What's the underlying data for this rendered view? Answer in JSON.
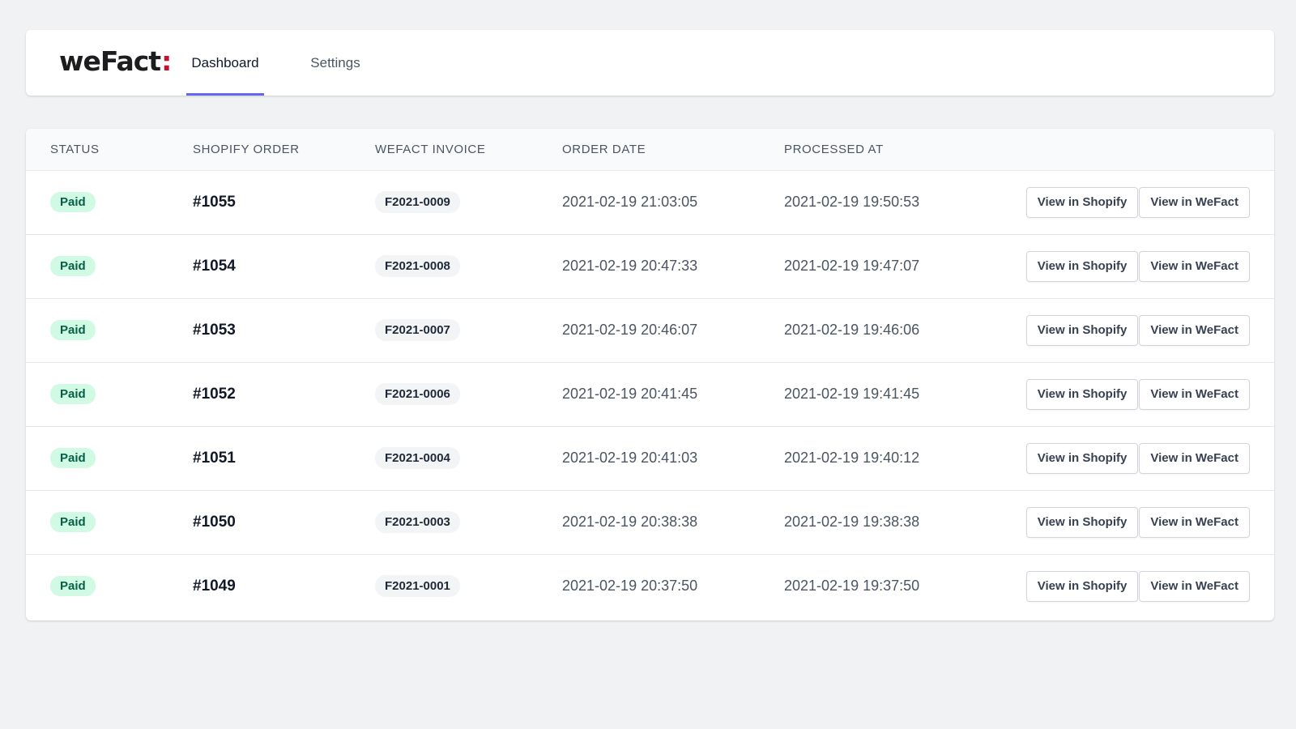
{
  "nav": {
    "logo_text": "weFact",
    "logo_colon": ":",
    "tabs": [
      {
        "label": "Dashboard",
        "active": true
      },
      {
        "label": "Settings",
        "active": false
      }
    ]
  },
  "table": {
    "headers": {
      "status": "STATUS",
      "shopify_order": "SHOPIFY ORDER",
      "wefact_invoice": "WEFACT INVOICE",
      "order_date": "ORDER DATE",
      "processed_at": "PROCESSED AT"
    },
    "action_labels": {
      "view_shopify": "View in Shopify",
      "view_wefact": "View in WeFact"
    },
    "rows": [
      {
        "status": "Paid",
        "order": "#1055",
        "invoice": "F2021-0009",
        "order_date": "2021-02-19 21:03:05",
        "processed_at": "2021-02-19 19:50:53"
      },
      {
        "status": "Paid",
        "order": "#1054",
        "invoice": "F2021-0008",
        "order_date": "2021-02-19 20:47:33",
        "processed_at": "2021-02-19 19:47:07"
      },
      {
        "status": "Paid",
        "order": "#1053",
        "invoice": "F2021-0007",
        "order_date": "2021-02-19 20:46:07",
        "processed_at": "2021-02-19 19:46:06"
      },
      {
        "status": "Paid",
        "order": "#1052",
        "invoice": "F2021-0006",
        "order_date": "2021-02-19 20:41:45",
        "processed_at": "2021-02-19 19:41:45"
      },
      {
        "status": "Paid",
        "order": "#1051",
        "invoice": "F2021-0004",
        "order_date": "2021-02-19 20:41:03",
        "processed_at": "2021-02-19 19:40:12"
      },
      {
        "status": "Paid",
        "order": "#1050",
        "invoice": "F2021-0003",
        "order_date": "2021-02-19 20:38:38",
        "processed_at": "2021-02-19 19:38:38"
      },
      {
        "status": "Paid",
        "order": "#1049",
        "invoice": "F2021-0001",
        "order_date": "2021-02-19 20:37:50",
        "processed_at": "2021-02-19 19:37:50"
      }
    ]
  },
  "colors": {
    "page_background": "#f1f2f4",
    "active_tab_underline": "#6366f1",
    "paid_badge_bg": "#d1fae5",
    "paid_badge_text": "#065f46",
    "logo_colon": "#c8102e"
  }
}
